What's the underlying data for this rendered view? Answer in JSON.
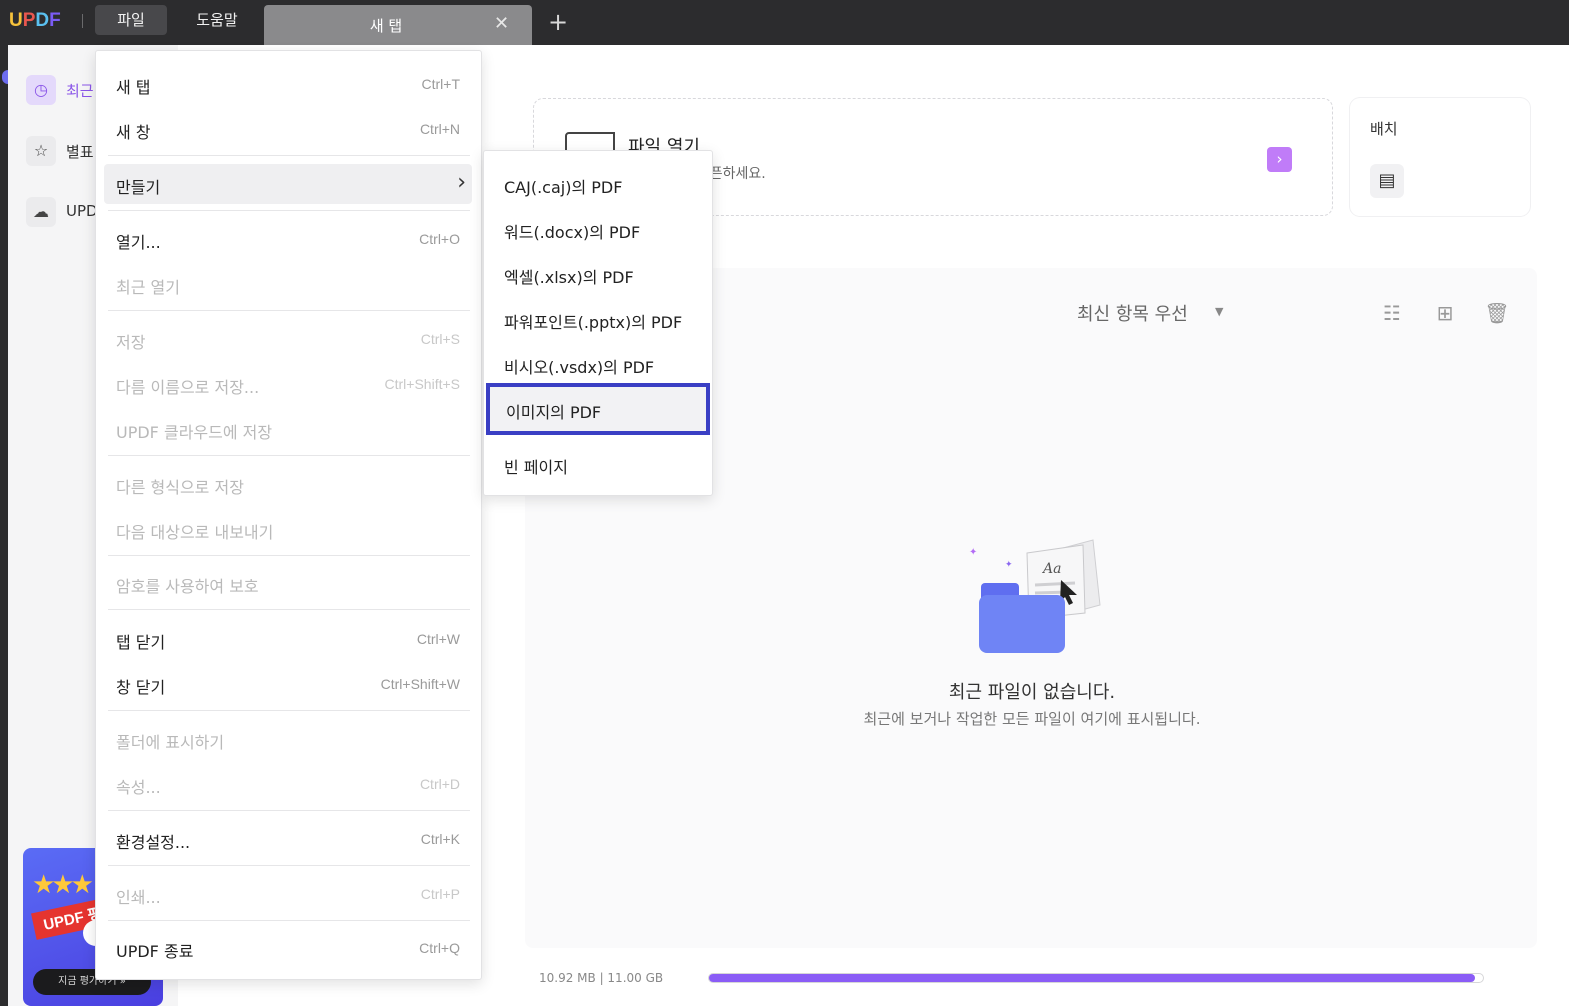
{
  "titlebar": {
    "menus": [
      "파일",
      "도움말"
    ],
    "tab_title": "새 탭",
    "tab_close": "✕",
    "new_tab": "+"
  },
  "sidebar": {
    "items": [
      {
        "label": "최근",
        "icon": "clock-icon"
      },
      {
        "label": "별표",
        "icon": "star-icon"
      },
      {
        "label": "UPD",
        "icon": "cloud-icon"
      }
    ],
    "promo": {
      "ribbon": "UPDF 평",
      "button": "지금 평가하기 »"
    }
  },
  "main": {
    "open_card": {
      "title": "파일 열기",
      "subtitle": "드래그하여 오픈하세요."
    },
    "batch_card": {
      "title": "배치"
    },
    "sort": {
      "selected": "최신 항목 우선"
    },
    "empty": {
      "title": "최근 파일이 없습니다.",
      "subtitle": "최근에 보거나 작업한 모든 파일이 여기에 표시됩니다."
    },
    "storage": {
      "text": "10.92 MB | 11.00 GB",
      "used_fraction": 0.99
    }
  },
  "file_menu": {
    "items": [
      {
        "label": "새 탭",
        "shortcut": "Ctrl+T"
      },
      {
        "label": "새 창",
        "shortcut": "Ctrl+N"
      },
      {
        "label": "만들기",
        "shortcut": ""
      },
      {
        "label": "열기...",
        "shortcut": "Ctrl+O"
      },
      {
        "label": "최근 열기",
        "shortcut": ""
      },
      {
        "label": "저장",
        "shortcut": "Ctrl+S"
      },
      {
        "label": "다름 이름으로 저장...",
        "shortcut": "Ctrl+Shift+S"
      },
      {
        "label": "UPDF 클라우드에 저장",
        "shortcut": ""
      },
      {
        "label": "다른 형식으로 저장",
        "shortcut": ""
      },
      {
        "label": "다음 대상으로 내보내기",
        "shortcut": ""
      },
      {
        "label": "암호를 사용하여 보호",
        "shortcut": ""
      },
      {
        "label": "탭 닫기",
        "shortcut": "Ctrl+W"
      },
      {
        "label": "창 닫기",
        "shortcut": "Ctrl+Shift+W"
      },
      {
        "label": "폴더에 표시하기",
        "shortcut": ""
      },
      {
        "label": "속성...",
        "shortcut": "Ctrl+D"
      },
      {
        "label": "환경설정...",
        "shortcut": "Ctrl+K"
      },
      {
        "label": "인쇄...",
        "shortcut": "Ctrl+P"
      },
      {
        "label": "UPDF 종료",
        "shortcut": "Ctrl+Q"
      }
    ]
  },
  "create_submenu": {
    "items": [
      "CAJ(.caj)의 PDF",
      "워드(.docx)의 PDF",
      "엑셀(.xlsx)의 PDF",
      "파워포인트(.pptx)의 PDF",
      "비시오(.vsdx)의 PDF",
      "이미지의 PDF",
      "빈 페이지"
    ]
  },
  "colors": {
    "accent": "#8a55e8",
    "highlight_border": "#3a3fc4",
    "titlebar": "#2c2c2e"
  }
}
